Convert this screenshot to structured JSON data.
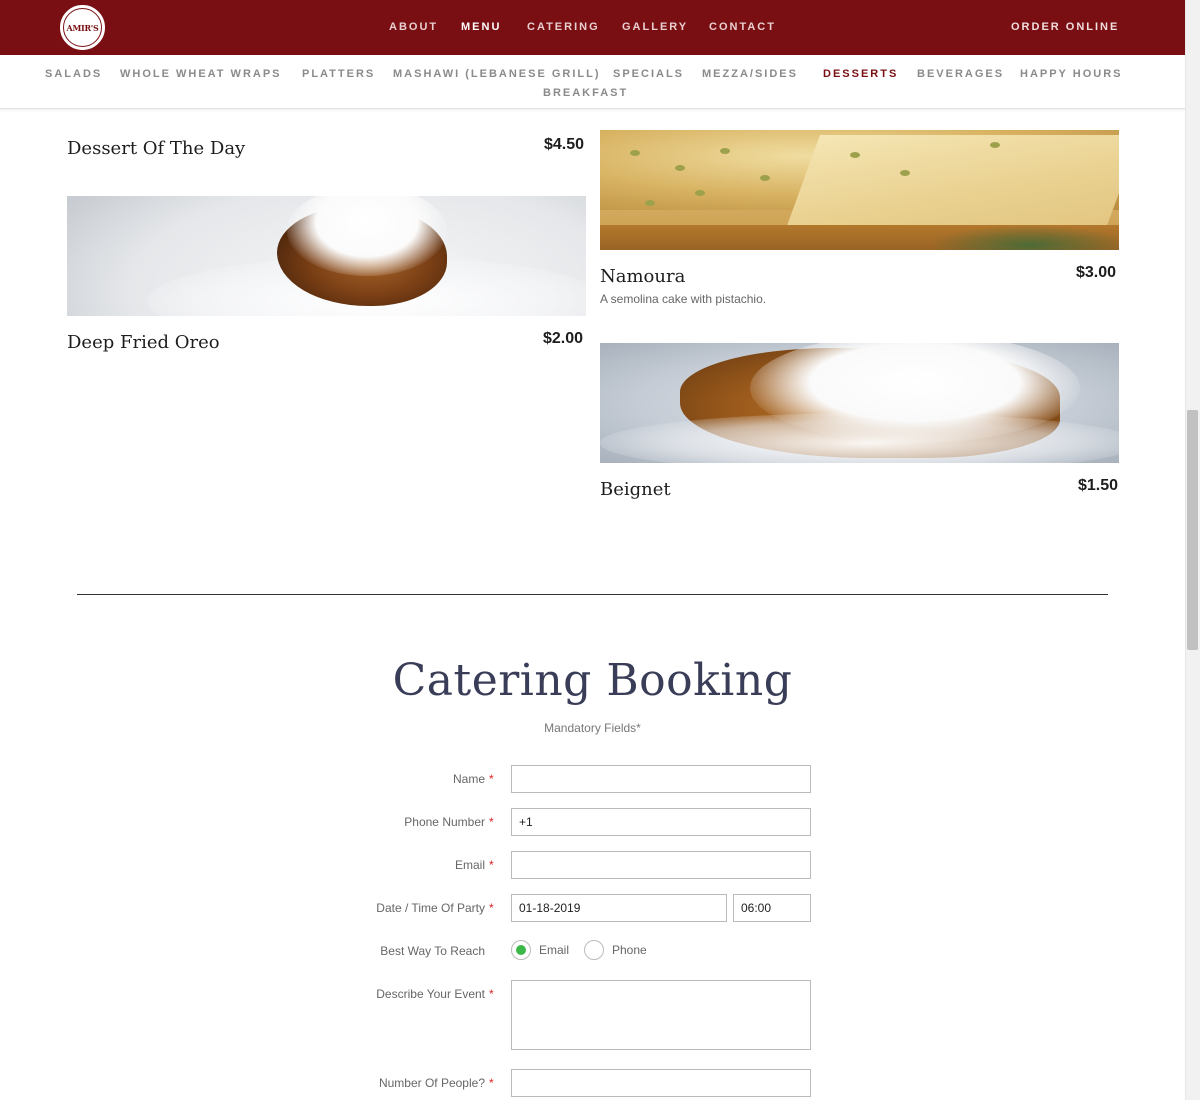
{
  "header": {
    "logo_text": "AMIR'S",
    "nav": [
      {
        "label": "ABOUT",
        "active": false
      },
      {
        "label": "MENU",
        "active": true
      },
      {
        "label": "CATERING",
        "active": false
      },
      {
        "label": "GALLERY",
        "active": false
      },
      {
        "label": "CONTACT",
        "active": false
      }
    ],
    "order_online": "ORDER ONLINE",
    "brand_color": "#7a0f13"
  },
  "subnav": {
    "items": [
      {
        "label": "SALADS",
        "active": false
      },
      {
        "label": "WHOLE WHEAT WRAPS",
        "active": false
      },
      {
        "label": "PLATTERS",
        "active": false
      },
      {
        "label": "MASHAWI (LEBANESE GRILL)",
        "active": false
      },
      {
        "label": "SPECIALS",
        "active": false
      },
      {
        "label": "MEZZA/SIDES",
        "active": false
      },
      {
        "label": "DESSERTS",
        "active": true
      },
      {
        "label": "BEVERAGES",
        "active": false
      },
      {
        "label": "HAPPY HOURS",
        "active": false
      },
      {
        "label": "BREAKFAST",
        "active": false
      }
    ]
  },
  "menu": {
    "items": [
      {
        "name": "Dessert Of The Day",
        "price": "$4.50",
        "description": ""
      },
      {
        "name": "Deep Fried Oreo",
        "price": "$2.00",
        "description": ""
      },
      {
        "name": "Namoura",
        "price": "$3.00",
        "description": "A semolina cake with pistachio."
      },
      {
        "name": "Beignet",
        "price": "$1.50",
        "description": ""
      }
    ]
  },
  "catering": {
    "title": "Catering Booking",
    "mandatory_note": "Mandatory Fields*",
    "required_mark": "*",
    "fields": {
      "name": {
        "label": "Name",
        "value": ""
      },
      "phone": {
        "label": "Phone Number",
        "value": "+1"
      },
      "email": {
        "label": "Email",
        "value": ""
      },
      "date_time": {
        "label": "Date / Time Of Party",
        "date": "01-18-2019",
        "time": "06:00"
      },
      "reach": {
        "label": "Best Way To Reach",
        "options": [
          "Email",
          "Phone"
        ],
        "selected": "Email"
      },
      "describe": {
        "label": "Describe Your Event",
        "value": ""
      },
      "people": {
        "label": "Number Of People?",
        "value": ""
      }
    },
    "accent_color": "#3cb84a"
  }
}
